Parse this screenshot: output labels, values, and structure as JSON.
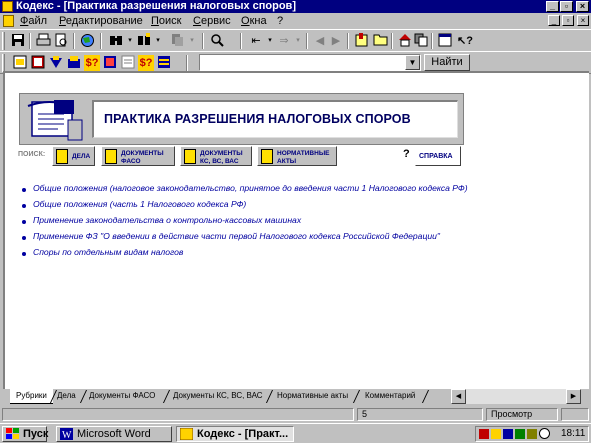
{
  "window": {
    "title": "Кодекс - [Практика разрешения налоговых споров]",
    "controls": {
      "minimize": "_",
      "restore": "▫",
      "close": "×"
    }
  },
  "menu": [
    "Файл",
    "Редактирование",
    "Поиск",
    "Сервис",
    "Окна",
    "?"
  ],
  "search_box": {
    "value": "",
    "find_button": "Найти"
  },
  "banner": {
    "title": "ПРАКТИКА РАЗРЕШЕНИЯ НАЛОГОВЫХ СПОРОВ"
  },
  "search_bar": {
    "label": "ПОИСК:",
    "buttons": [
      {
        "line1": "ДЕЛА",
        "line2": ""
      },
      {
        "line1": "ДОКУМЕНТЫ",
        "line2": "ФАСО"
      },
      {
        "line1": "ДОКУМЕНТЫ",
        "line2": "КС, ВС, ВАС"
      },
      {
        "line1": "НОРМАТИВНЫЕ",
        "line2": "АКТЫ"
      }
    ],
    "help_mark": "?",
    "help_button": "СПРАВКА"
  },
  "links": [
    "Общие положения (налоговое законодательство, принятое до введения части 1 Налогового кодекса РФ)",
    "Общие положения (часть 1 Налогового кодекса РФ)",
    "Применение законодательства о контрольно-кассовых машинах",
    "Применение ФЗ \"О введении в действие части первой Налогового кодекса Российской Федерации\"",
    "Споры по отдельным видам налогов"
  ],
  "tabs": [
    "Рубрики",
    "Дела",
    "Документы ФАСО",
    "Документы КС, ВС, ВАС",
    "Нормативные акты",
    "Комментарий"
  ],
  "status": {
    "page": "5",
    "mode": "Просмотр"
  },
  "taskbar": {
    "start": "Пуск",
    "items": [
      "Microsoft Word",
      "Кодекс - [Практ..."
    ],
    "clock": "18:11"
  }
}
